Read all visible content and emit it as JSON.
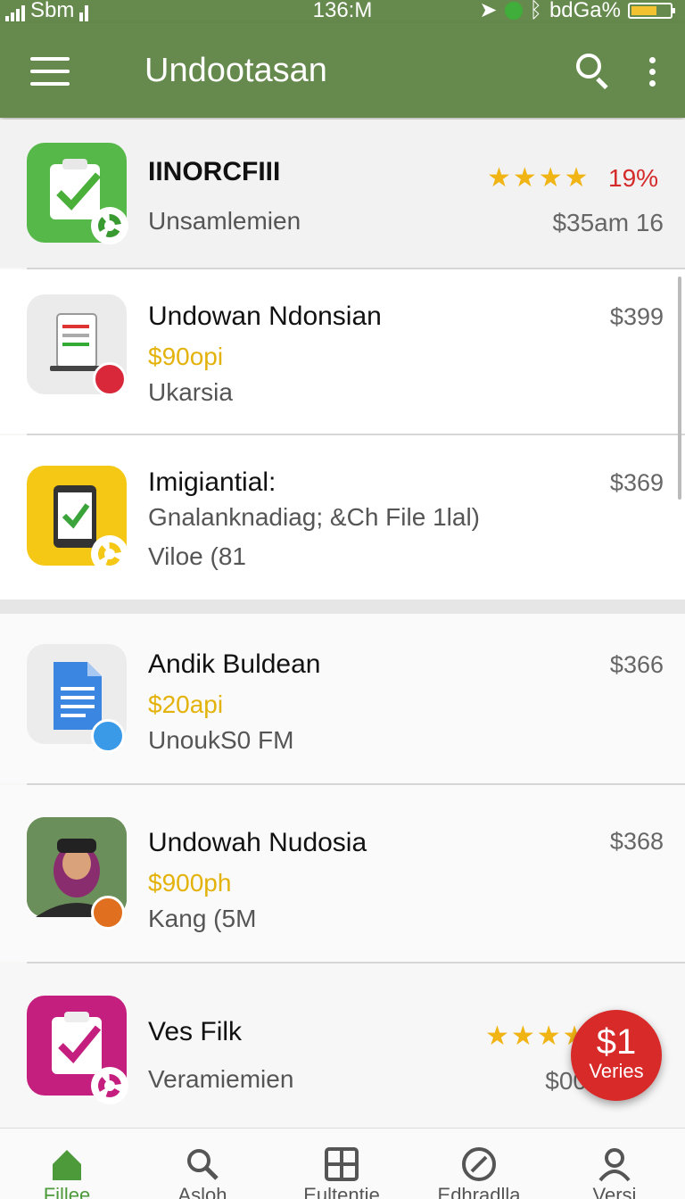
{
  "status_bar": {
    "carrier": "Sbm",
    "time": "136:M",
    "right_text": "bdGa%"
  },
  "app_bar": {
    "title": "Undootasan",
    "search_icon": "search-icon",
    "more_icon": "more-vert-icon"
  },
  "colors": {
    "primary": "#668a4d",
    "accent_gold": "#e3b20b",
    "accent_red": "#d92a2a",
    "nav_active": "#4d9a3a"
  },
  "featured": {
    "name": "IINORCFIII",
    "subtitle": "Unsamlemien",
    "rating": 4.5,
    "rating_pct": "19%",
    "price": "$35am 16"
  },
  "items": [
    {
      "name": "Undowan Ndonsian",
      "line2": "$90opi",
      "line3": "Ukarsia",
      "price": "$399"
    },
    {
      "name": "Imigiantial:",
      "line2": "Gnalanknadiag; &Ch File 1lal)",
      "line3": "Viloe (81",
      "price": "$369"
    },
    {
      "name": "Andik Buldean",
      "line2": "$20api",
      "line3": "UnoukS0 FM",
      "price": "$366"
    },
    {
      "name": "Undowah Nudosia",
      "line2": "$900ph",
      "line3": "Kang (5M",
      "price": "$368"
    }
  ],
  "last_item": {
    "name": "Ves Filk",
    "subtitle": "Veramiemien",
    "price": "$00",
    "rating": 4
  },
  "fab": {
    "amount": "$1",
    "label": "Veries"
  },
  "bottom_nav": [
    {
      "label": "Fillee",
      "icon": "home-icon",
      "active": true
    },
    {
      "label": "Asloh",
      "icon": "search-icon",
      "active": false
    },
    {
      "label": "Eultentie",
      "icon": "grid-icon",
      "active": false
    },
    {
      "label": "Edhradlla",
      "icon": "compass-icon",
      "active": false
    },
    {
      "label": "Versi",
      "icon": "person-icon",
      "active": false
    }
  ]
}
